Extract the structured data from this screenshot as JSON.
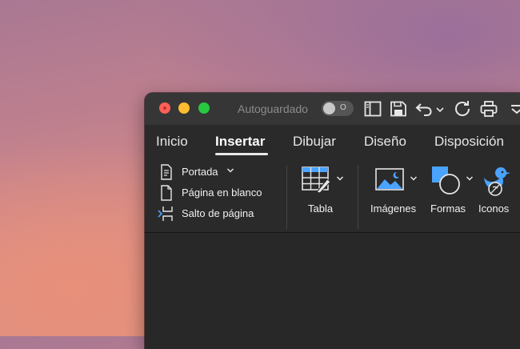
{
  "window": {
    "autosave_label": "Autoguardado",
    "autosave_toggle_state": "O",
    "traffic_light_colors": {
      "close": "#fe5f57",
      "minimize": "#febc2e",
      "zoom": "#28c840"
    },
    "toolbar_icons": [
      "sidebar-icon",
      "save-icon",
      "undo-icon",
      "chevron-down-icon",
      "redo-icon",
      "print-icon",
      "more-icon"
    ]
  },
  "tabs": [
    {
      "label": "Inicio",
      "active": false
    },
    {
      "label": "Insertar",
      "active": true
    },
    {
      "label": "Dibujar",
      "active": false
    },
    {
      "label": "Diseño",
      "active": false
    },
    {
      "label": "Disposición",
      "active": false
    }
  ],
  "ribbon": {
    "pages_group": [
      {
        "label": "Portada",
        "icon": "cover-page-icon",
        "has_dropdown": true
      },
      {
        "label": "Página en blanco",
        "icon": "blank-page-icon",
        "has_dropdown": false
      },
      {
        "label": "Salto de página",
        "icon": "page-break-icon",
        "has_dropdown": false
      }
    ],
    "table": {
      "label": "Tabla",
      "icon": "table-icon"
    },
    "images": {
      "label": "Imágenes",
      "icon": "images-icon"
    },
    "shapes": {
      "label": "Formas",
      "icon": "shapes-icon"
    },
    "icons": {
      "label": "Iconos",
      "icon": "icons-icon"
    }
  },
  "colors": {
    "accent_blue": "#4aa3ff",
    "ribbon_background": "#2a2a2a",
    "titlebar_background": "#363636"
  }
}
